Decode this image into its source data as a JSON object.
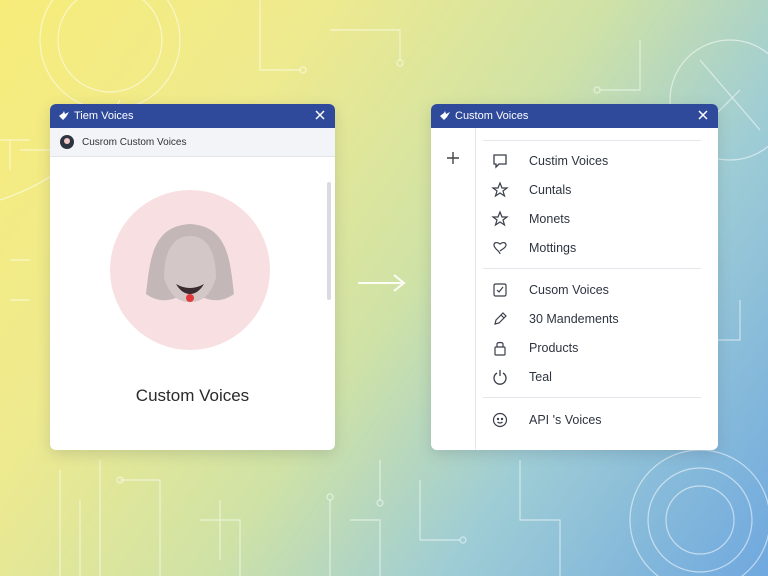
{
  "left_window": {
    "title": "Tiem Voices",
    "subheader": "Cusrom Custom Voices",
    "caption": "Custom Voices"
  },
  "right_window": {
    "title": "Custom Voices",
    "menu_groups": [
      [
        {
          "label": "Custim Voices",
          "icon": "chat-bubble-icon"
        },
        {
          "label": "Cuntals",
          "icon": "star-icon"
        },
        {
          "label": "Monets",
          "icon": "star-icon"
        },
        {
          "label": "Mottings",
          "icon": "heart-icon"
        }
      ],
      [
        {
          "label": "Cusom Voices",
          "icon": "checkbox-icon"
        },
        {
          "label": "30 Mandements",
          "icon": "pencil-icon"
        },
        {
          "label": "Products",
          "icon": "lock-icon"
        },
        {
          "label": "Teal",
          "icon": "power-icon"
        }
      ],
      [
        {
          "label": "API 's Voices",
          "icon": "smiley-icon"
        }
      ]
    ]
  },
  "colors": {
    "titlebar": "#2f4a9a",
    "avatar_circle": "#f8e0e2",
    "accent_red": "#e23a3a"
  }
}
